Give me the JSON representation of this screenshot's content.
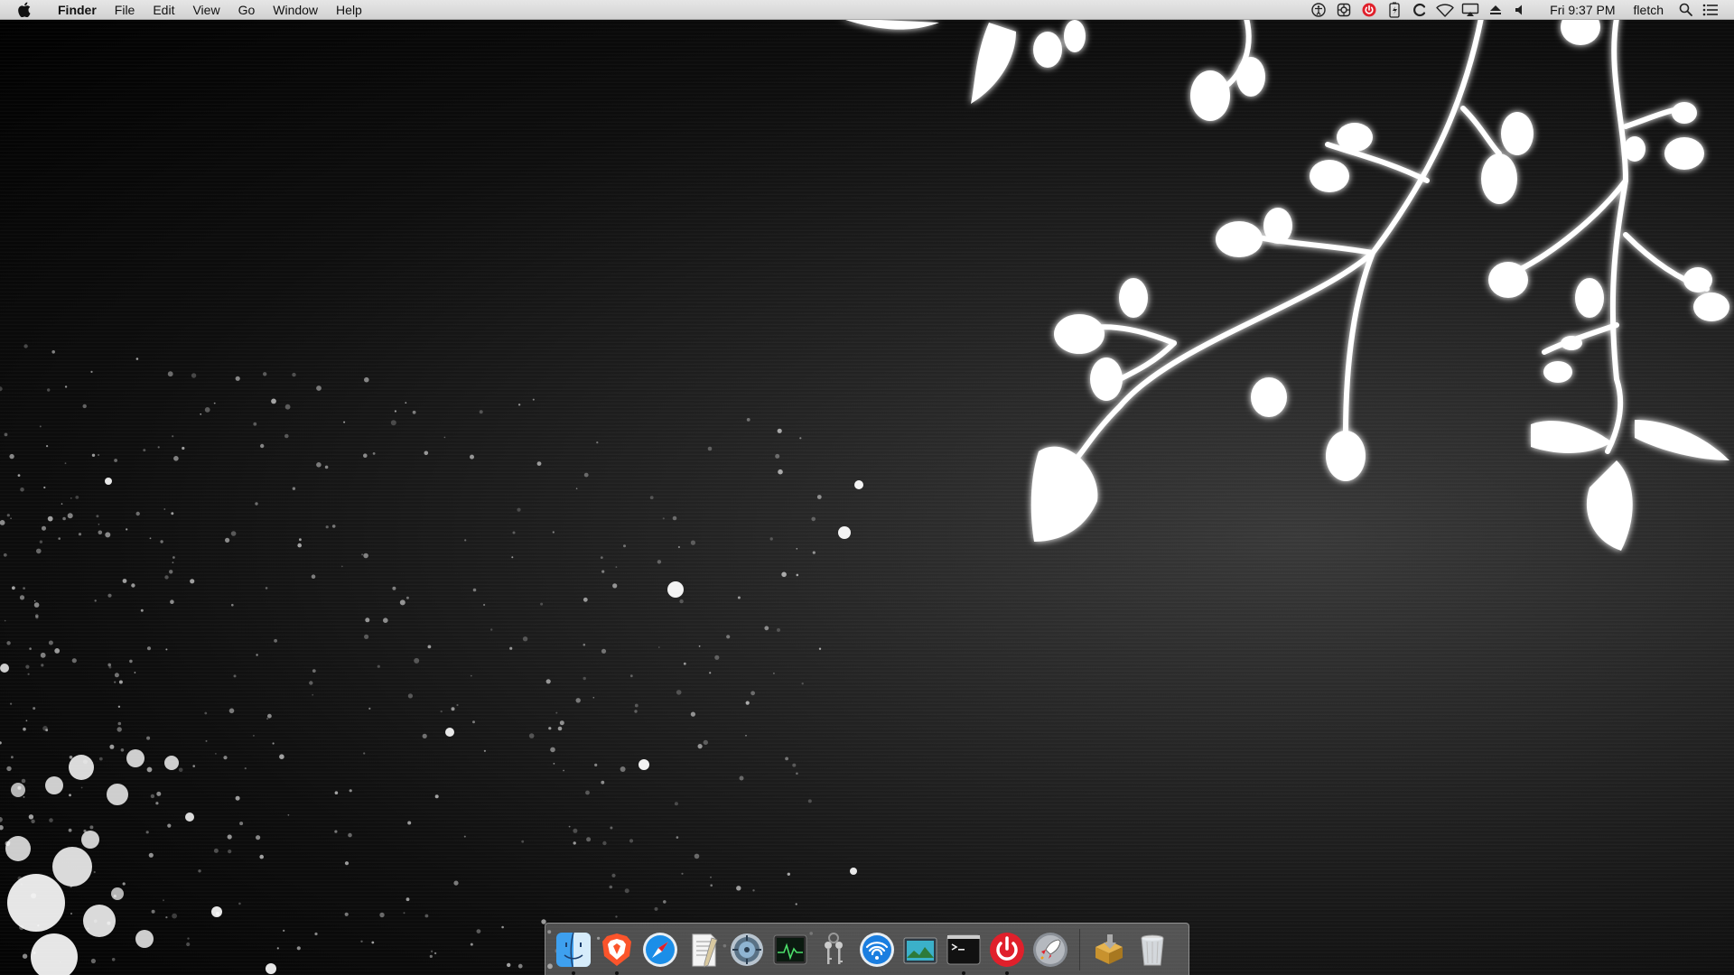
{
  "menubar": {
    "apple_icon": "apple-logo",
    "app_name": "Finder",
    "menus": [
      "File",
      "Edit",
      "View",
      "Go",
      "Window",
      "Help"
    ],
    "status_icons": [
      "accessibility-icon",
      "app-extension-icon",
      "power-app-icon",
      "battery-charging-icon",
      "c-app-icon",
      "wifi-icon",
      "airplay-icon",
      "eject-icon",
      "volume-icon"
    ],
    "clock": "Fri 9:37 PM",
    "user": "fletch",
    "spotlight_icon": "search-icon",
    "notification_icon": "notification-center-icon"
  },
  "dock": {
    "apps": [
      {
        "name": "Finder",
        "icon": "finder-icon",
        "running": true
      },
      {
        "name": "Brave Browser",
        "icon": "brave-icon",
        "running": true
      },
      {
        "name": "Safari",
        "icon": "safari-icon",
        "running": false
      },
      {
        "name": "TextEdit",
        "icon": "textedit-icon",
        "running": false
      },
      {
        "name": "Disk Utility",
        "icon": "disk-utility-icon",
        "running": false
      },
      {
        "name": "Activity Monitor",
        "icon": "activity-monitor-icon",
        "running": false
      },
      {
        "name": "Keychain Access",
        "icon": "keychain-icon",
        "running": false
      },
      {
        "name": "Wireless Diagnostics",
        "icon": "wifi-diagnostics-icon",
        "running": false
      },
      {
        "name": "Preview",
        "icon": "preview-icon",
        "running": false
      },
      {
        "name": "Terminal",
        "icon": "terminal-icon",
        "running": true
      },
      {
        "name": "Power App",
        "icon": "power-icon",
        "running": true
      },
      {
        "name": "Launchpad",
        "icon": "launchpad-icon",
        "running": false
      }
    ],
    "extras": [
      {
        "name": "Installer",
        "icon": "installer-icon"
      },
      {
        "name": "Trash",
        "icon": "trash-icon"
      }
    ]
  },
  "colors": {
    "menubar_bg": "#dcdcdc",
    "wallpaper_dark": "#000000",
    "wallpaper_gray": "#2a2a2a",
    "accent_red": "#e0202b"
  }
}
